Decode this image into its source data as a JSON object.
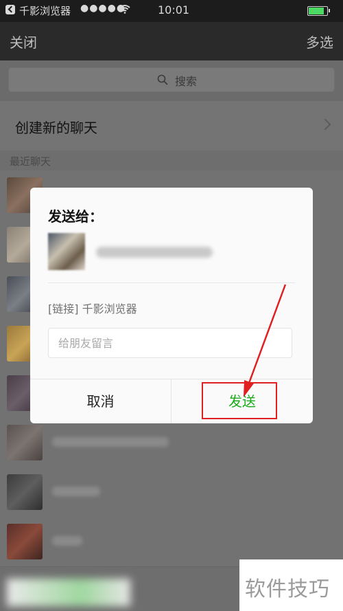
{
  "status_bar": {
    "app_label": "千影浏览器",
    "signal": "●●●●●",
    "time": "10:01",
    "colors": {
      "battery": "#4cd964"
    }
  },
  "nav": {
    "close": "关闭",
    "multi_select": "多选"
  },
  "search": {
    "placeholder": "搜索"
  },
  "new_chat": {
    "label": "创建新的聊天"
  },
  "recent": {
    "section_label": "最近聊天"
  },
  "dialog": {
    "title": "发送给：",
    "link_text": "[链接] 千影浏览器",
    "message_placeholder": "给朋友留言",
    "cancel_label": "取消",
    "send_label": "发送",
    "colors": {
      "send": "#1aad19"
    }
  },
  "watermark": {
    "text": "软件技巧"
  }
}
